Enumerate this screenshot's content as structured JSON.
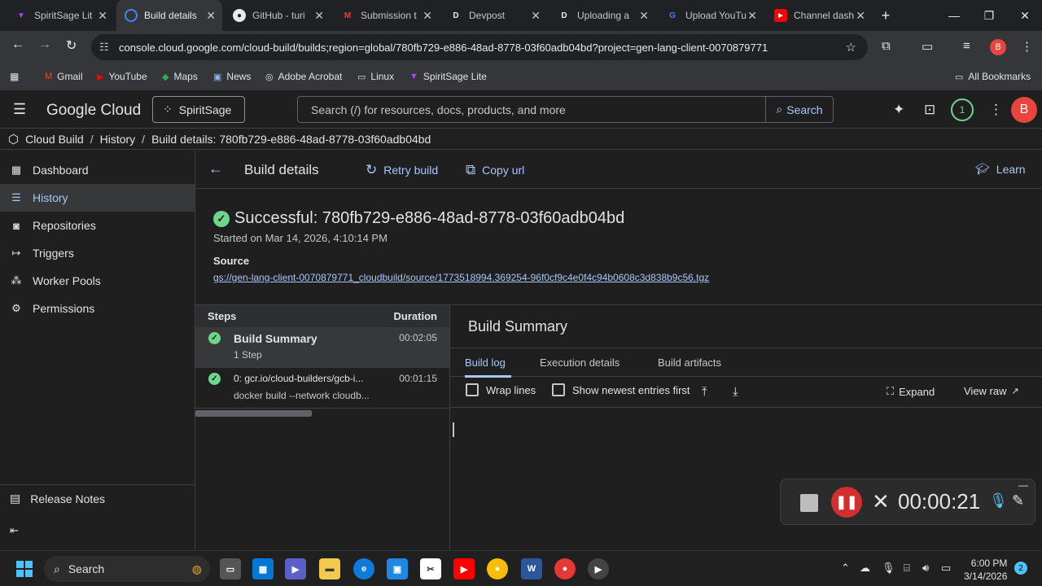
{
  "browser": {
    "tabs": [
      {
        "title": "SpiritSage Lit",
        "icon": "spiritsage-icon",
        "color": "#a142f4"
      },
      {
        "title": "Build details",
        "icon": "gcp-icon",
        "color": "#4285f4"
      },
      {
        "title": "GitHub - turi",
        "icon": "github-icon",
        "color": "#e8eaed"
      },
      {
        "title": "Submission t",
        "icon": "gmail-icon",
        "color": "#ea4335"
      },
      {
        "title": "Devpost",
        "icon": "devpost-icon",
        "color": "#003e54"
      },
      {
        "title": "Uploading a",
        "icon": "devpost-icon",
        "color": "#003e54"
      },
      {
        "title": "Upload YouTu",
        "icon": "google-icon",
        "color": "#4285f4"
      },
      {
        "title": "Channel dash",
        "icon": "youtube-icon",
        "color": "#ff0000"
      }
    ],
    "url": "console.cloud.google.com/cloud-build/builds;region=global/780fb729-e886-48ad-8778-03f60adb04bd?project=gen-lang-client-0070879771",
    "profile_initial": "B",
    "bookmarks": [
      {
        "label": "Gmail",
        "icon": "gmail-icon"
      },
      {
        "label": "YouTube",
        "icon": "youtube-icon"
      },
      {
        "label": "Maps",
        "icon": "maps-icon"
      },
      {
        "label": "News",
        "icon": "news-icon"
      },
      {
        "label": "Adobe Acrobat",
        "icon": "acrobat-icon"
      },
      {
        "label": "Linux",
        "icon": "folder-icon"
      },
      {
        "label": "SpiritSage Lite",
        "icon": "spiritsage-icon"
      }
    ],
    "all_bookmarks": "All Bookmarks"
  },
  "console": {
    "product": "Google Cloud",
    "project": "SpiritSage",
    "search_placeholder": "Search (/) for resources, docs, products, and more",
    "search_button": "Search",
    "notification_count": "1",
    "avatar_initial": "B"
  },
  "breadcrumb": {
    "items": [
      "Cloud Build",
      "History",
      "Build details: 780fb729-e886-48ad-8778-03f60adb04bd"
    ]
  },
  "sidebar": {
    "items": [
      {
        "label": "Dashboard",
        "icon": "dashboard-icon"
      },
      {
        "label": "History",
        "icon": "list-icon"
      },
      {
        "label": "Repositories",
        "icon": "repo-icon"
      },
      {
        "label": "Triggers",
        "icon": "trigger-icon"
      },
      {
        "label": "Worker Pools",
        "icon": "pool-icon"
      },
      {
        "label": "Permissions",
        "icon": "gear-icon"
      }
    ],
    "release_notes": "Release Notes"
  },
  "page": {
    "title": "Build details",
    "retry_label": "Retry build",
    "copy_label": "Copy url",
    "learn_label": "Learn",
    "status": "Successful: 780fb729-e886-48ad-8778-03f60adb04bd",
    "started": "Started on Mar 14, 2026, 4:10:14 PM",
    "source_label": "Source",
    "source_link": "gs://gen-lang-client-0070879771_cloudbuild/source/1773518994.369254-96f0cf9c4e0f4c94b0608c3d838b9c56.tgz"
  },
  "steps": {
    "col_steps": "Steps",
    "col_duration": "Duration",
    "rows": [
      {
        "title": "Build Summary",
        "subtitle": "1 Step",
        "duration": "00:02:05"
      },
      {
        "title": "0: gcr.io/cloud-builders/gcb-i...",
        "subtitle": "docker build --network cloudb...",
        "duration": "00:01:15"
      }
    ]
  },
  "summary": {
    "title": "Build Summary",
    "tabs": [
      "Build log",
      "Execution details",
      "Build artifacts"
    ],
    "wrap_lines": "Wrap lines",
    "newest_first": "Show newest entries first",
    "expand": "Expand",
    "view_raw": "View raw"
  },
  "recorder": {
    "time": "00:00:21"
  },
  "taskbar": {
    "search": "Search",
    "time": "6:00 PM",
    "date": "3/14/2026",
    "notifications": "2"
  }
}
